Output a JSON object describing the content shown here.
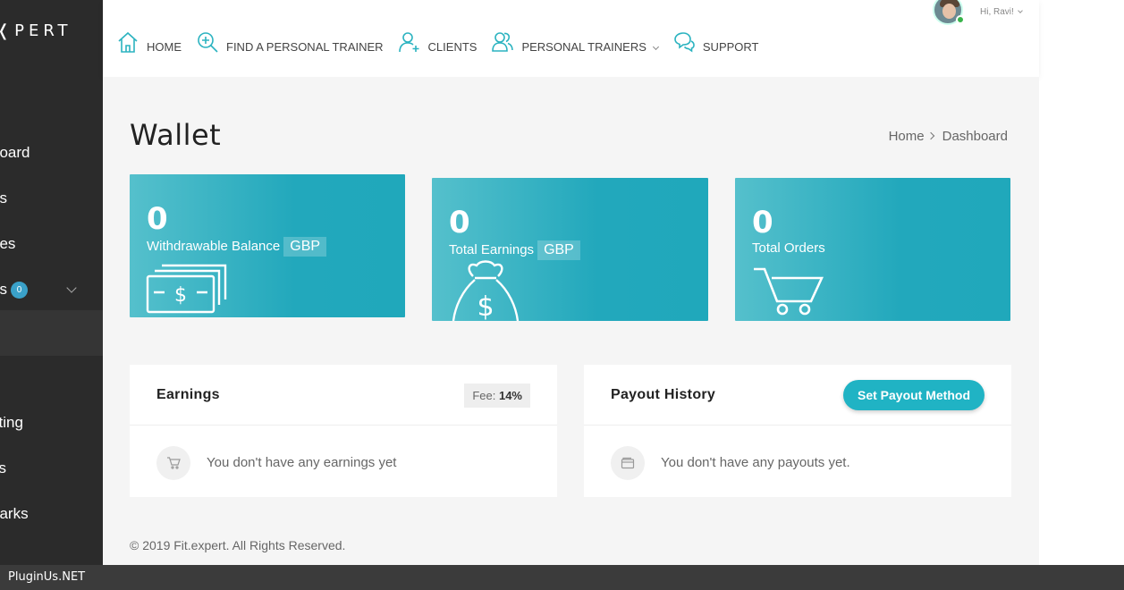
{
  "brand": {
    "logo_text": "PERT"
  },
  "sidebar": {
    "items": [
      {
        "label": "board"
      },
      {
        "label": "gs"
      },
      {
        "label": "ges"
      },
      {
        "label": "gs",
        "badge": "0"
      },
      {
        "label": "sting"
      },
      {
        "label": "ys"
      },
      {
        "label": "narks"
      }
    ]
  },
  "nav": {
    "items": [
      {
        "label": "HOME",
        "icon": "home-icon"
      },
      {
        "label": "FIND A PERSONAL TRAINER",
        "icon": "search-plus-icon"
      },
      {
        "label": "CLIENTS",
        "icon": "add-user-icon"
      },
      {
        "label": "PERSONAL TRAINERS",
        "icon": "users-icon"
      },
      {
        "label": "SUPPORT",
        "icon": "chat-icon"
      }
    ]
  },
  "user": {
    "greeting": "Hi, Ravi!"
  },
  "page": {
    "title": "Wallet",
    "breadcrumb": [
      "Home",
      "Dashboard"
    ]
  },
  "stats": [
    {
      "value": "0",
      "label": "Withdrawable Balance",
      "currency": "GBP",
      "icon": "cash-icon"
    },
    {
      "value": "0",
      "label": "Total Earnings",
      "currency": "GBP",
      "icon": "money-bag-icon"
    },
    {
      "value": "0",
      "label": "Total Orders",
      "icon": "cart-icon"
    }
  ],
  "earnings": {
    "title": "Earnings",
    "fee_label": "Fee:",
    "fee_value": "14%",
    "empty_message": "You don't have any earnings yet"
  },
  "payout": {
    "title": "Payout History",
    "button_label": "Set Payout Method",
    "empty_message": "You don't have any payouts yet."
  },
  "footer": {
    "text": "© 2019 Fit.expert. All Rights Reserved."
  },
  "statusbar": {
    "text": "PluginUs.NET"
  },
  "colors": {
    "accent": "#20b3c4",
    "sidebar": "#2b2b2b"
  }
}
